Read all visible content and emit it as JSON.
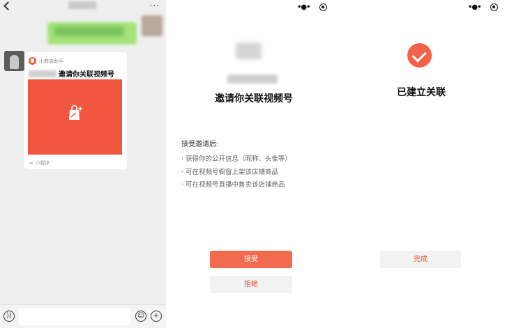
{
  "chat": {
    "header": {
      "back_icon": "chevron-left-icon",
      "more_icon": "more-icon",
      "more_glyph": "···"
    },
    "card": {
      "brand_name": "小商店助手",
      "title": "邀请你关联视频号",
      "footer_label": "小程序",
      "image_color": "#f0573e"
    },
    "input_bar": {
      "voice_icon": "voice-icon",
      "emoji_icon": "emoji-icon",
      "plus_icon": "plus-icon"
    }
  },
  "invite": {
    "title": "邀请你关联视频号",
    "accept_heading": "接受邀请后:",
    "benefits": [
      "· 获得你的公开信息（昵称、头像等）",
      "· 可在视频号橱窗上架该店铺商品",
      "· 可在视频号直播中售卖该店铺商品"
    ],
    "accept_button": "接受",
    "reject_button": "拒绝"
  },
  "done": {
    "title": "已建立关联",
    "finish_button": "完成"
  },
  "colors": {
    "accent": "#f26b4f",
    "card_red": "#f0573e",
    "chat_bg": "#efefef",
    "secondary_button_bg": "#f2f2f2"
  }
}
